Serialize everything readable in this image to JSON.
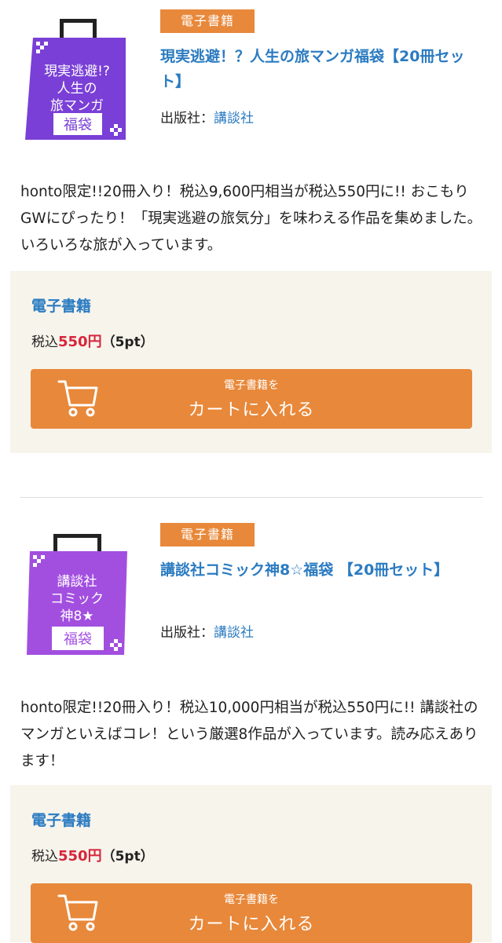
{
  "products": [
    {
      "badge": "電子書籍",
      "bag": {
        "line1": "現実逃避!?",
        "line2": "人生の",
        "line3": "旅マンガ",
        "tag": "福袋",
        "color": "#7a3fd6"
      },
      "title": "現実逃避！？人生の旅マンガ福袋【20冊セット】",
      "publisher_label": "出版社：",
      "publisher": "講談社",
      "description": "honto限定!!20冊入り！税込9,600円相当が税込550円に!! おこもりGWにぴったり！「現実逃避の旅気分」を味わえる作品を集めました。いろいろな旅が入っています。",
      "format": "電子書籍",
      "price_prefix": "税込",
      "price": "550円",
      "points": "（5pt）",
      "cart_sub": "電子書籍を",
      "cart_main": "カートに入れる"
    },
    {
      "badge": "電子書籍",
      "bag": {
        "line1": "講談社",
        "line2": "コミック",
        "line3": "神8★",
        "tag": "福袋",
        "color": "#a24fe0"
      },
      "title": "講談社コミック神8☆福袋 【20冊セット】",
      "publisher_label": "出版社：",
      "publisher": "講談社",
      "description": "honto限定!!20冊入り！税込10,000円相当が税込550円に!! 講談社のマンガといえばコレ！という厳選8作品が入っています。読み応えあります！",
      "format": "電子書籍",
      "price_prefix": "税込",
      "price": "550円",
      "points": "（5pt）",
      "cart_sub": "電子書籍を",
      "cart_main": "カートに入れる"
    }
  ],
  "colors": {
    "accent": "#e8883a",
    "link": "#2b7bc1",
    "price": "#d6263b",
    "panel": "#f7f4ec"
  }
}
